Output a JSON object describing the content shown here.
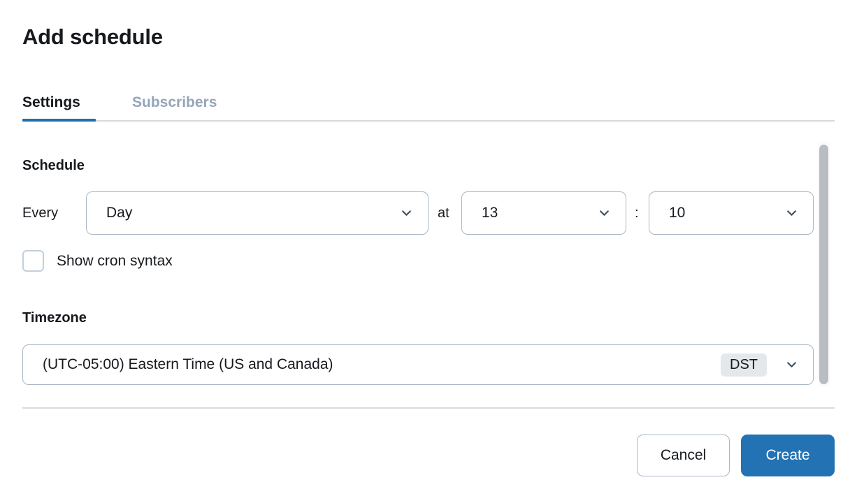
{
  "dialog": {
    "title": "Add schedule"
  },
  "tabs": [
    {
      "label": "Settings",
      "active": true
    },
    {
      "label": "Subscribers",
      "active": false
    }
  ],
  "schedule": {
    "section_label": "Schedule",
    "every_label": "Every",
    "frequency_value": "Day",
    "at_label": "at",
    "hour_value": "13",
    "separator": ":",
    "minute_value": "10",
    "cron_checkbox_label": "Show cron syntax",
    "cron_checkbox_checked": false
  },
  "timezone": {
    "section_label": "Timezone",
    "value": "(UTC-05:00) Eastern Time (US and Canada)",
    "dst_badge": "DST"
  },
  "footer": {
    "cancel_label": "Cancel",
    "create_label": "Create"
  },
  "colors": {
    "accent": "#1f6ead",
    "primary_button": "#2272b4",
    "text": "#16191d",
    "muted_tab": "#95a5b8",
    "border": "#aab7c4",
    "divider": "#d5dbdb",
    "badge_bg": "#e5e8eb",
    "scrollbar_thumb": "#b9bdc2"
  }
}
